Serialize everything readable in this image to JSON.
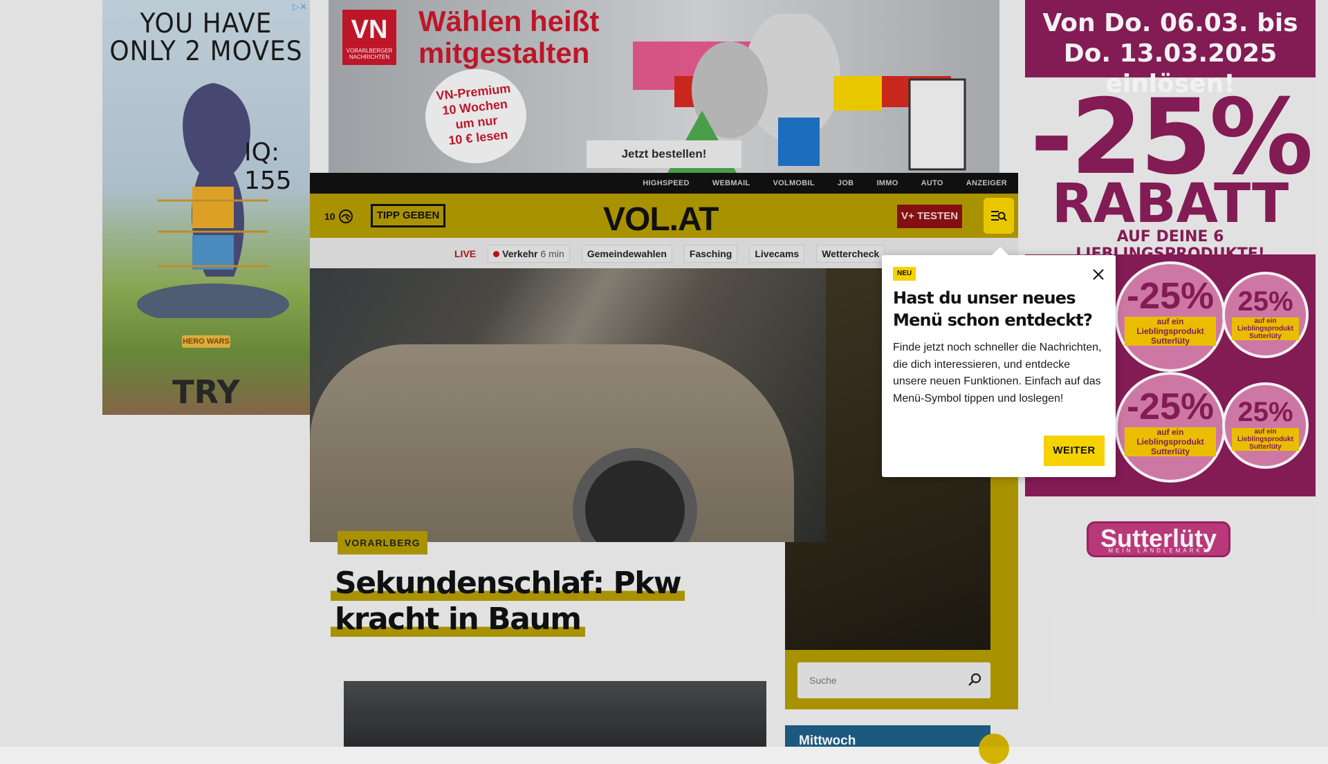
{
  "ads": {
    "left": {
      "line1": "YOU HAVE",
      "line2": "ONLY 2 MOVES",
      "iq": "IQ: 155",
      "brand": "HERO WARS",
      "cta": "TRY",
      "adchoice": "▷✕"
    },
    "top": {
      "logo_letters": "VN",
      "logo_sub": "VORARLBERGER NACHRICHTEN",
      "headline_1": "Wählen heißt",
      "headline_2": "mitgestalten",
      "badge_1": "VN-Premium",
      "badge_2": "10 Wochen",
      "badge_3": "um nur",
      "badge_4": "10 € lesen",
      "cta": "Jetzt bestellen!"
    },
    "right": {
      "date_1": "Von Do. 06.03. bis",
      "date_2": "Do. 13.03.2025 einlösen!",
      "percent": "-25%",
      "rabatt": "RABATT",
      "sub": "AUF DEINE 6 LIEBLINGSPRODUKTE!",
      "sticker_pct": "-25%",
      "sticker_pct_small": "25%",
      "sticker_text": "auf ein Lieblingsprodukt",
      "sticker_brand": "Sutterlüty",
      "logo": "Sutterlüty",
      "logo_sub": "MEIN LÄNDLEMARKT"
    }
  },
  "topbar": {
    "links": [
      "HIGHSPEED",
      "WEBMAIL",
      "VOLMOBIL",
      "JOB",
      "IMMO",
      "AUTO",
      "ANZEIGER"
    ]
  },
  "header": {
    "temperature": "10",
    "tipp_label": "TIPP GEBEN",
    "logo": "VOL.AT",
    "vplus_label": "V+ TESTEN",
    "menu_icon": "menu-search-icon"
  },
  "subnav": {
    "live": "LIVE",
    "verkehr": "Verkehr",
    "verkehr_time": "6 min",
    "items": [
      "Gemeindewahlen",
      "Fasching",
      "Livecams",
      "Wettercheck"
    ]
  },
  "article": {
    "category": "VORARLBERG",
    "title": "Sekundenschlaf: Pkw kracht in Baum"
  },
  "search": {
    "placeholder": "Suche"
  },
  "weather": {
    "day": "Mittwoch"
  },
  "popup": {
    "badge": "NEU",
    "title": "Hast du unser neues Menü schon entdeckt?",
    "body": "Finde jetzt noch schneller die Nachrichten, die dich interessieren, und entdecke unsere neuen Funktionen. Einfach auf das Menü-Symbol tippen und loslegen!",
    "button": "WEITER"
  },
  "colors": {
    "brand_yellow": "#f6d200",
    "header_dim": "#b39a00",
    "vplus_red": "#8a1115",
    "sutterluety": "#8b1d5a"
  }
}
